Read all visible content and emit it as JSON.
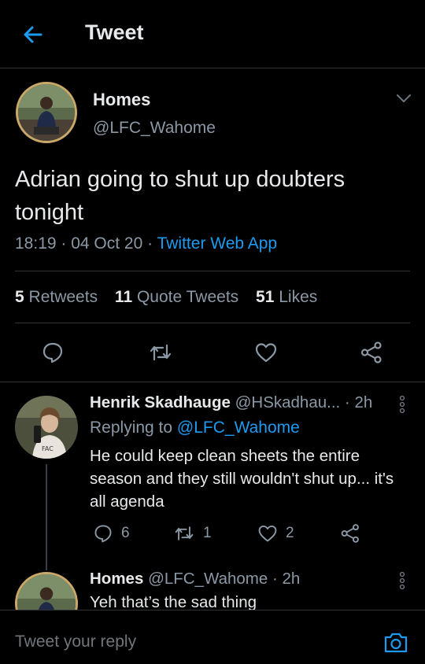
{
  "header": {
    "title": "Tweet"
  },
  "tweet": {
    "name": "Homes",
    "handle": "@LFC_Wahome",
    "text": "Adrian going to shut up doubters tonight",
    "time": "18:19",
    "date": "04 Oct 20",
    "source": "Twitter Web App",
    "retweets_count": "5",
    "retweets_label": "Retweets",
    "quotes_count": "11",
    "quotes_label": "Quote Tweets",
    "likes_count": "51",
    "likes_label": "Likes"
  },
  "replies": [
    {
      "name": "Henrik Skadhauge",
      "handle": "@HSkadhau...",
      "time": "2h",
      "replying_prefix": "Replying to",
      "replying_to": "@LFC_Wahome",
      "text": "He could keep clean sheets the entire season and they still wouldn't shut up... it's all agenda",
      "replies_count": "6",
      "retweets_count": "1",
      "likes_count": "2"
    },
    {
      "name": "Homes",
      "handle": "@LFC_Wahome",
      "time": "2h",
      "text": "Yeh that’s the sad thing"
    }
  ],
  "composer": {
    "placeholder": "Tweet your reply"
  },
  "colors": {
    "accent": "#1d9bf0",
    "muted": "#8b98a5",
    "background": "#000000"
  },
  "icons": [
    "back-arrow-icon",
    "chevron-down-icon",
    "reply-icon",
    "retweet-icon",
    "like-icon",
    "share-icon",
    "more-vertical-icon",
    "camera-icon"
  ]
}
